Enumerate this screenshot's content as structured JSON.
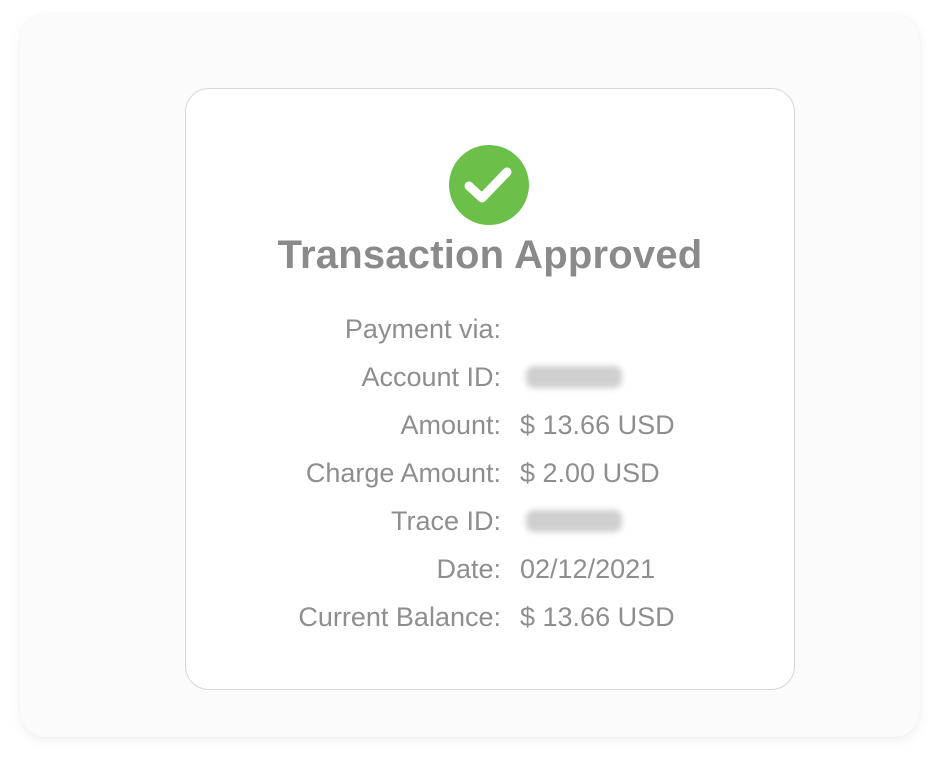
{
  "status": {
    "icon": "check-circle-icon",
    "color": "#6cc04a",
    "title": "Transaction Approved"
  },
  "details": {
    "rows": [
      {
        "label": "Payment via:",
        "value": ""
      },
      {
        "label": "Account ID:",
        "value": "",
        "redacted": true
      },
      {
        "label": "Amount:",
        "value": "$ 13.66 USD"
      },
      {
        "label": "Charge Amount:",
        "value": "$ 2.00 USD"
      },
      {
        "label": "Trace ID:",
        "value": "",
        "redacted": true
      },
      {
        "label": "Date:",
        "value": "02/12/2021"
      },
      {
        "label": "Current Balance:",
        "value": "$ 13.66 USD"
      }
    ]
  }
}
